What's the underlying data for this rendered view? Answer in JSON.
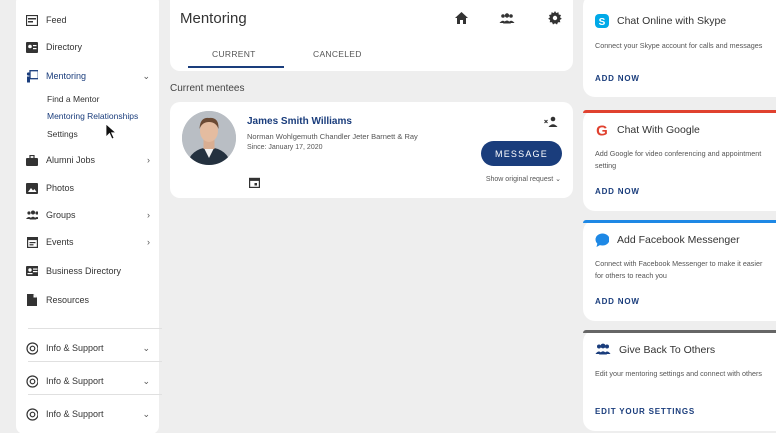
{
  "sidebar": {
    "items": [
      {
        "label": "Feed",
        "icon": "feed-icon"
      },
      {
        "label": "Directory",
        "icon": "directory-icon"
      },
      {
        "label": "Mentoring",
        "icon": "mentoring-icon"
      },
      {
        "label": "Alumni Jobs",
        "icon": "briefcase-icon"
      },
      {
        "label": "Photos",
        "icon": "photo-icon"
      },
      {
        "label": "Groups",
        "icon": "groups-icon"
      },
      {
        "label": "Events",
        "icon": "calendar-icon"
      },
      {
        "label": "Business Directory",
        "icon": "business-card-icon"
      },
      {
        "label": "Resources",
        "icon": "document-icon"
      }
    ],
    "mentoring_sub": [
      "Find a Mentor",
      "Mentoring Relationships",
      "Settings"
    ],
    "support": [
      "Info & Support",
      "Info & Support",
      "Info & Support"
    ]
  },
  "header": {
    "title": "Mentoring",
    "tabs": [
      "CURRENT",
      "CANCELED"
    ]
  },
  "section_label": "Current mentees",
  "mentee": {
    "name": "James Smith Williams",
    "company": "Norman Wohlgemuth Chandler Jeter Barnett & Ray",
    "since": "Since: January 17, 2020",
    "button": "MESSAGE",
    "show_request": "Show original request"
  },
  "cards": [
    {
      "title": "Chat Online with Skype",
      "desc": "Connect your Skype account for calls and messages",
      "action": "ADD NOW",
      "color": "#00a9e8"
    },
    {
      "title": "Chat With Google",
      "desc": "Add Google for video conferencing and appointment setting",
      "action": "ADD NOW",
      "color": "#e0412f"
    },
    {
      "title": "Add Facebook Messenger",
      "desc": "Connect with Facebook Messenger to make it easier for others to reach you",
      "action": "ADD NOW",
      "color": "#1e88e5"
    },
    {
      "title": "Give Back To Others",
      "desc": "Edit your mentoring settings and connect with others",
      "action": "EDIT YOUR SETTINGS",
      "color": "#666666"
    }
  ],
  "colors": {
    "accent": "#1a3d7c"
  }
}
